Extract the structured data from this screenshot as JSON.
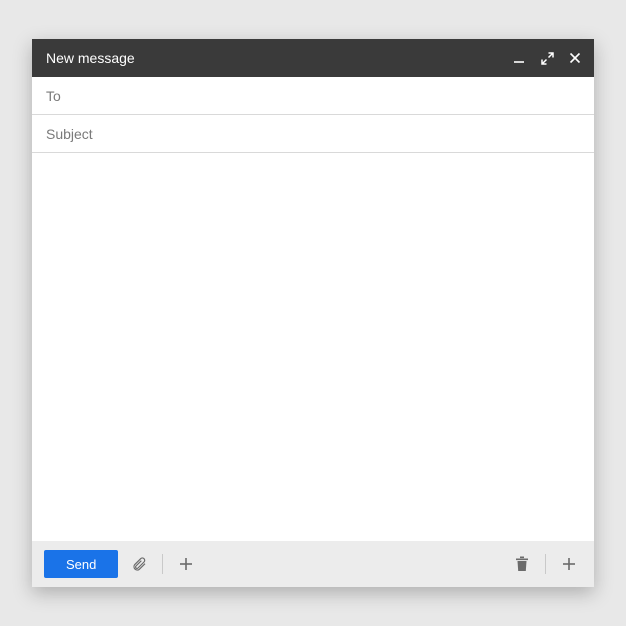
{
  "window": {
    "title": "New message"
  },
  "fields": {
    "to_placeholder": "To",
    "to_value": "",
    "subject_placeholder": "Subject",
    "subject_value": "",
    "body_value": ""
  },
  "toolbar": {
    "send_label": "Send"
  },
  "icons": {
    "minimize": "minimize-icon",
    "expand": "expand-icon",
    "close": "close-icon",
    "attach": "paperclip-icon",
    "insert_left": "plus-icon",
    "trash": "trash-icon",
    "insert_right": "plus-icon"
  },
  "colors": {
    "titlebar_bg": "#3a3a3a",
    "send_bg": "#1a73e8",
    "toolbar_bg": "#ececec",
    "page_bg": "#e8e8e8"
  }
}
